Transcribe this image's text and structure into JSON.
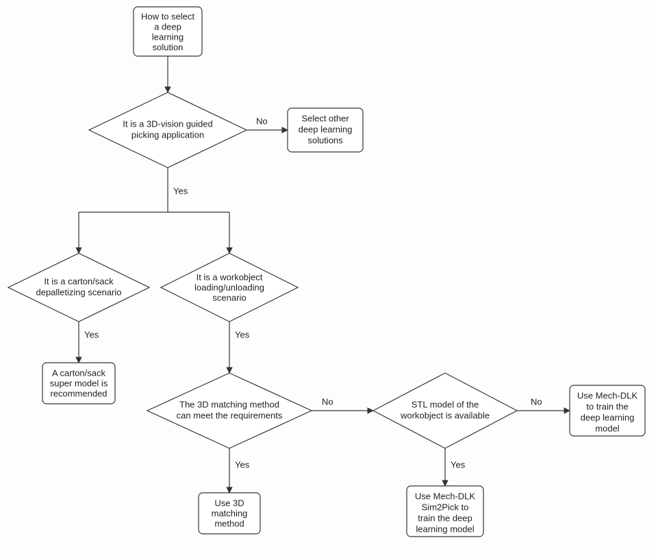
{
  "chart_data": {
    "type": "flowchart",
    "nodes": {
      "start": {
        "shape": "rect",
        "lines": [
          "How to select",
          "a deep",
          "learning",
          "solution"
        ]
      },
      "d1": {
        "shape": "diamond",
        "lines": [
          "It is a 3D-vision guided",
          "picking application"
        ]
      },
      "other": {
        "shape": "rect",
        "lines": [
          "Select other",
          "deep learning",
          "solutions"
        ]
      },
      "d2": {
        "shape": "diamond",
        "lines": [
          "It is a carton/sack",
          "depalletizing scenario"
        ]
      },
      "d3": {
        "shape": "diamond",
        "lines": [
          "It is a workobject",
          "loading/unloading",
          "scenario"
        ]
      },
      "super": {
        "shape": "rect",
        "lines": [
          "A carton/sack",
          "super model is",
          "recommended"
        ]
      },
      "d4": {
        "shape": "diamond",
        "lines": [
          "The 3D matching method",
          "can meet the requirements"
        ]
      },
      "use3d": {
        "shape": "rect",
        "lines": [
          "Use 3D",
          "matching",
          "method"
        ]
      },
      "d5": {
        "shape": "diamond",
        "lines": [
          "STL model of the",
          "workobject is available"
        ]
      },
      "sim2pick": {
        "shape": "rect",
        "lines": [
          "Use Mech-DLK",
          "Sim2Pick to",
          "train the deep",
          "learning model"
        ]
      },
      "mechdlk": {
        "shape": "rect",
        "lines": [
          "Use Mech-DLK",
          "to train the",
          "deep learning",
          "model"
        ]
      }
    },
    "edges": [
      {
        "from": "start",
        "to": "d1"
      },
      {
        "from": "d1",
        "to": "other",
        "label": "No"
      },
      {
        "from": "d1",
        "to": [
          "d2",
          "d3"
        ],
        "label": "Yes"
      },
      {
        "from": "d2",
        "to": "super",
        "label": "Yes"
      },
      {
        "from": "d3",
        "to": "d4",
        "label": "Yes"
      },
      {
        "from": "d4",
        "to": "use3d",
        "label": "Yes"
      },
      {
        "from": "d4",
        "to": "d5",
        "label": "No"
      },
      {
        "from": "d5",
        "to": "sim2pick",
        "label": "Yes"
      },
      {
        "from": "d5",
        "to": "mechdlk",
        "label": "No"
      }
    ],
    "labels": {
      "yes": "Yes",
      "no": "No"
    }
  }
}
